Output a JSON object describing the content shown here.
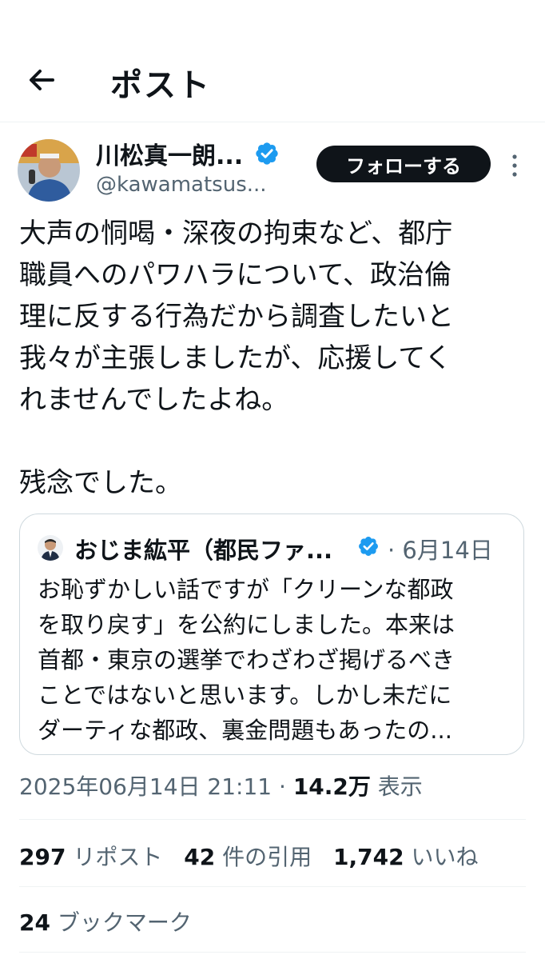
{
  "header": {
    "title": "ポスト"
  },
  "post": {
    "author_name": "川松真一朗...",
    "handle": "@kawamatsus...",
    "follow_label": "フォローする",
    "lines": [
      "大声の恫喝・深夜の拘束など、都庁",
      "職員へのパワハラについて、政治倫",
      "理に反する行為だから調査したいと",
      "我々が主張しましたが、応援してく",
      "れませんでしたよね。"
    ],
    "line_last": "残念でした。"
  },
  "quote": {
    "author_name": "おじま紘平（都民ファ...",
    "date": "· 6月14日",
    "lines": [
      "お恥ずかしい話ですが「クリーンな都政",
      "を取り戻す」を公約にしました。本来は",
      "首都・東京の選挙でわざわざ掲げるべき",
      "ことではないと思います。しかし未だに",
      "ダーティな都政、裏金問題もあったの..."
    ]
  },
  "meta": {
    "timestamp": "2025年06月14日 21:11",
    "separator": " · ",
    "views": "14.2万",
    "views_label": " 表示"
  },
  "stats": {
    "reposts": "297",
    "reposts_label": " リポスト",
    "quotes": "42",
    "quotes_label": " 件の引用",
    "likes": "1,742",
    "likes_label": " いいね",
    "bookmarks": "24",
    "bookmarks_label": " ブックマーク"
  },
  "icons": {
    "back": "arrow-left-icon",
    "verified": "verified-badge-icon",
    "more": "more-vertical-icon"
  },
  "colors": {
    "text": "#0f1419",
    "secondary": "#536471",
    "verified": "#1d9bf0",
    "border": "#cfd9de"
  }
}
